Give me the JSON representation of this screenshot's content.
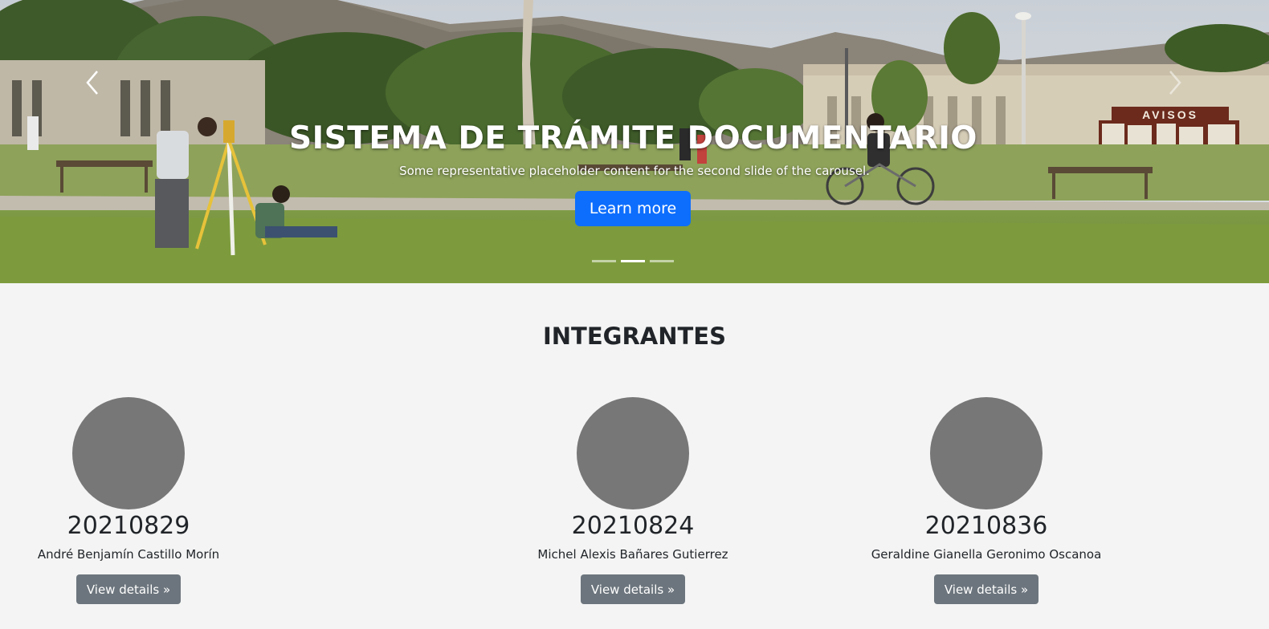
{
  "carousel": {
    "title": "SISTEMA DE TRÁMITE DOCUMENTARIO",
    "subtitle": "Some representative placeholder content for the second slide of the carousel.",
    "button_label": "Learn more",
    "slides": 3,
    "active_slide": 2,
    "sign_text": "AVISOS",
    "prev_icon": "chevron-left-icon",
    "next_icon": "chevron-right-icon",
    "accent": "#0d6efd"
  },
  "members_section": {
    "title": "INTEGRANTES",
    "members": [
      {
        "code": "20210824",
        "name": "Michel Alexis Bañares Gutierrez",
        "button_label": "View details »"
      },
      {
        "code": "20210836",
        "name": "Geraldine Gianella Geronimo Oscanoa",
        "button_label": "View details »"
      },
      {
        "code": "20210829",
        "name": "André Benjamín Castillo Morín",
        "button_label": "View details »"
      }
    ],
    "avatar_color": "#777777",
    "button_color": "#6c757d"
  }
}
